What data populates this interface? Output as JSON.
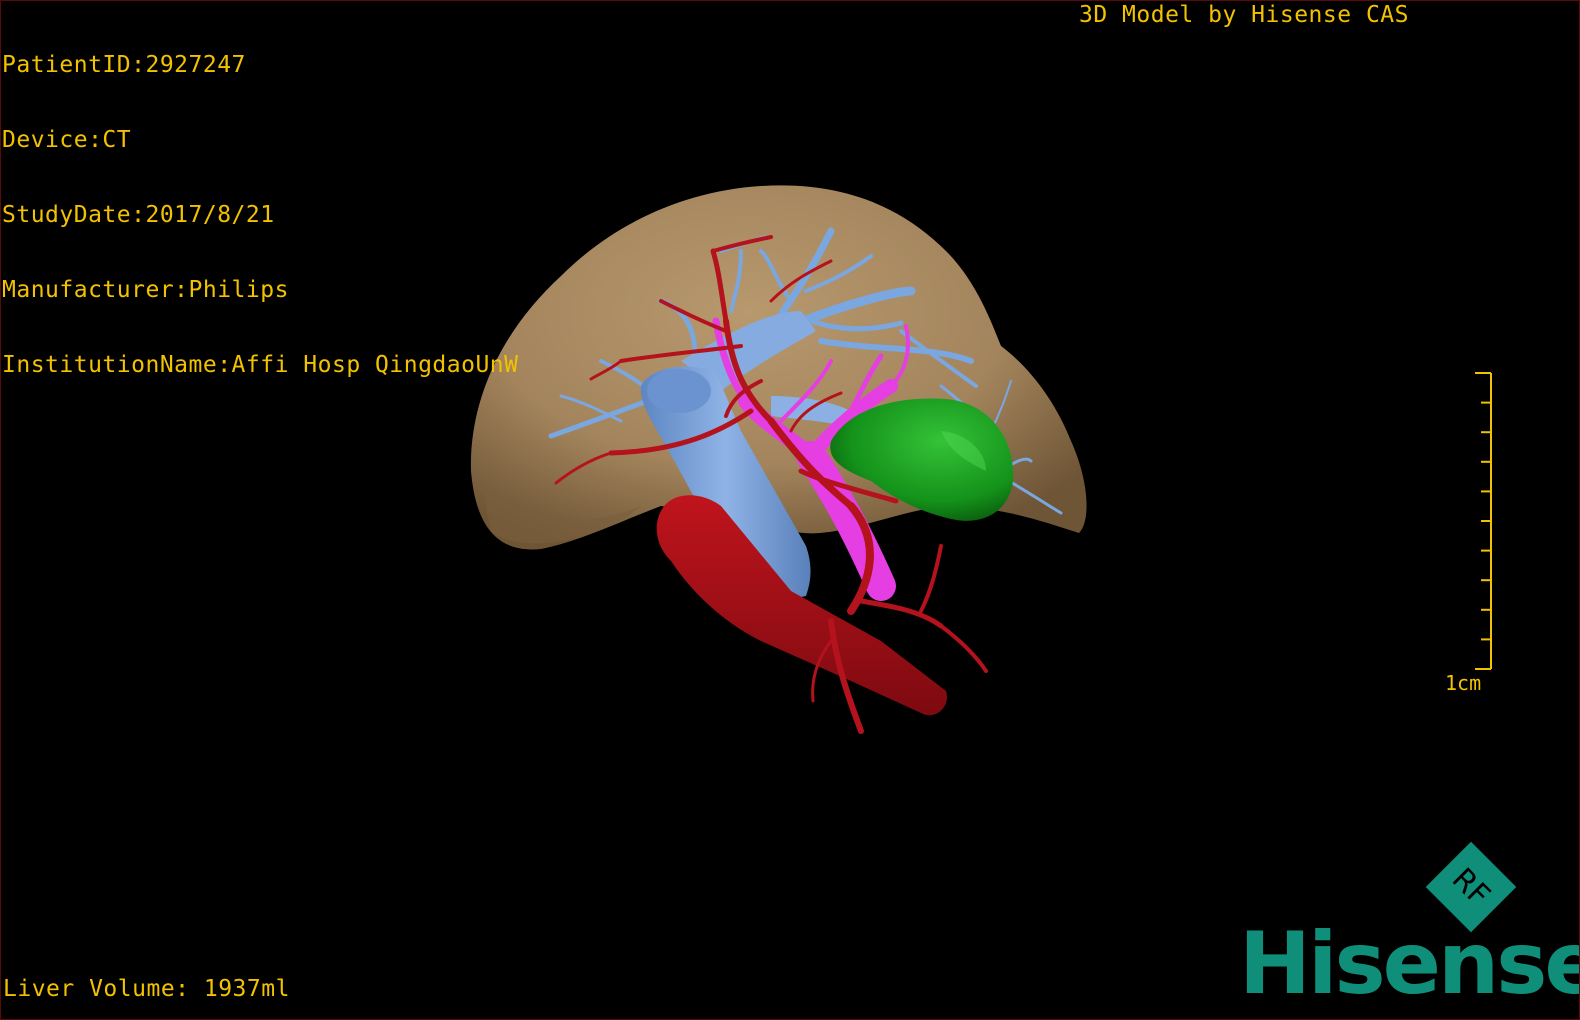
{
  "patient_info": {
    "patient_id": "PatientID:2927247",
    "device": "Device:CT",
    "study_date": "StudyDate:2017/8/21",
    "manufacturer": "Manufacturer:Philips",
    "institution": "InstitutionName:Affi Hosp QingdaoUnW"
  },
  "model_credit": "3D Model by Hisense CAS",
  "liver_volume": "Liver Volume: 1937ml",
  "scale": {
    "label": "1cm"
  },
  "logo": {
    "badge_text": "RF",
    "brand": "Hisense"
  },
  "colors": {
    "overlay_text": "#f2c200",
    "liver": "#a98a63",
    "hepatic_vein": "#7aa7df",
    "portal_vein": "#e53fe3",
    "artery": "#b4121c",
    "gallbladder": "#18a31c",
    "brand": "#0f8f7a"
  }
}
